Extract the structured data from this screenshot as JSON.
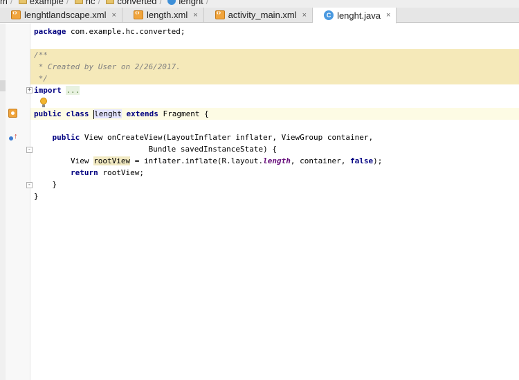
{
  "breadcrumb": [
    {
      "label": "m",
      "icon": "none"
    },
    {
      "label": "example",
      "icon": "folder-icon"
    },
    {
      "label": "hc",
      "icon": "folder-icon"
    },
    {
      "label": "converted",
      "icon": "folder-icon"
    },
    {
      "label": "lenght",
      "icon": "java-class-icon"
    }
  ],
  "tabs": [
    {
      "label": "lenghtlandscape.xml",
      "type": "xml",
      "active": false,
      "close": "×"
    },
    {
      "label": "length.xml",
      "type": "xml",
      "active": false,
      "close": "×"
    },
    {
      "label": "activity_main.xml",
      "type": "xml",
      "active": false,
      "close": "×"
    },
    {
      "label": "lenght.java",
      "type": "java",
      "active": true,
      "close": "×"
    }
  ],
  "java_icon_letter": "C",
  "code": {
    "package_kw": "package",
    "package_name": " com.example.hc.converted;",
    "doc_open": "/**",
    "doc_line": " * Created by User on 2/26/2017.",
    "doc_close": " */",
    "import_kw": "import",
    "import_fold": "...",
    "class_line": {
      "kw_public": "public",
      "kw_class": " class ",
      "class_name": "lenght",
      "kw_extends": " extends ",
      "rest": "Fragment {"
    },
    "method_line1": {
      "indent": "    ",
      "kw_public": "public",
      "rest": " View onCreateView(LayoutInflater inflater, ViewGroup container,"
    },
    "method_line2": "                         Bundle savedInstanceState) {",
    "body_line1": {
      "indent": "        ",
      "pre": "View ",
      "var": "rootView",
      "mid": " = inflater.inflate(R.layout.",
      "field": "length",
      "mid2": ", container, ",
      "kw_false": "false",
      "end": ");"
    },
    "body_line2": {
      "indent": "        ",
      "kw_return": "return",
      "rest": " rootView;"
    },
    "close_method": "    }",
    "close_class": "}"
  },
  "colors": {
    "keyword": "#000080",
    "comment": "#808080",
    "field": "#660e7a",
    "doc_background": "#f5e9b9"
  }
}
